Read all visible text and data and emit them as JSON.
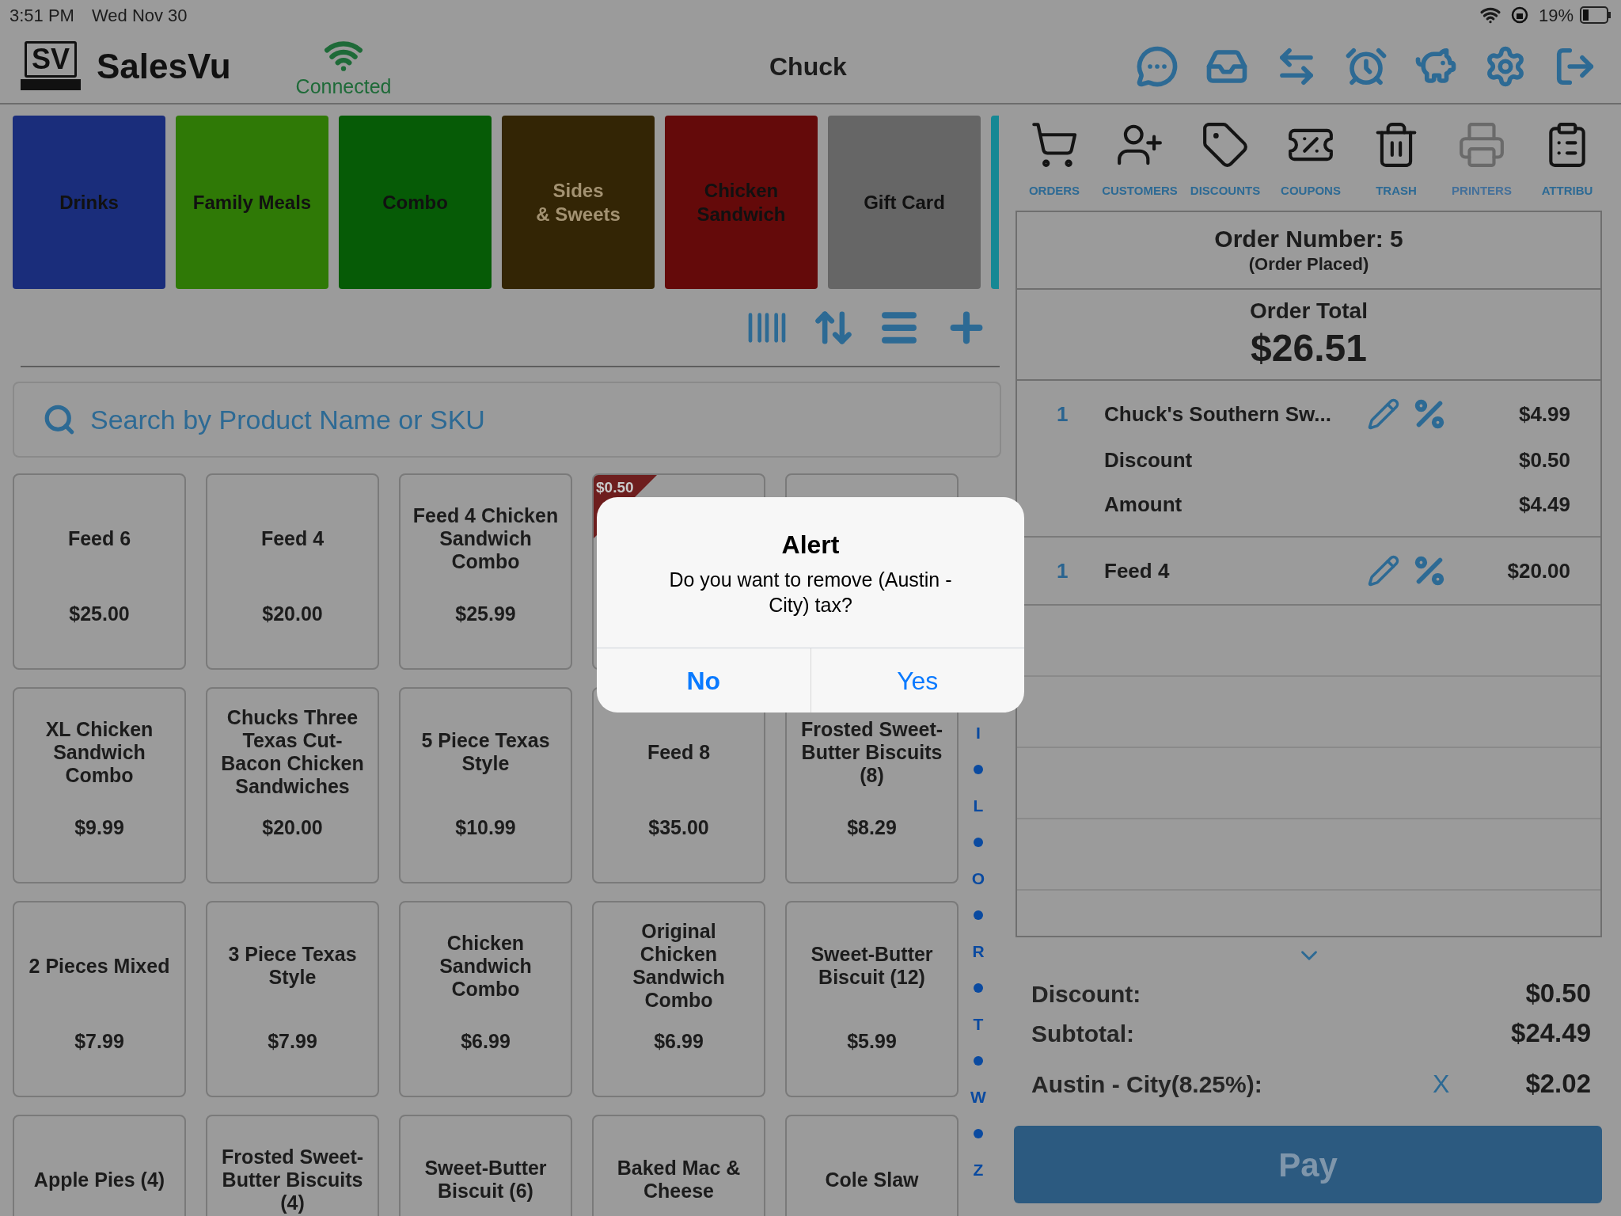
{
  "status_bar": {
    "time": "3:51 PM",
    "date": "Wed Nov 30",
    "battery": "19%"
  },
  "header": {
    "logo_text": "SV",
    "brand": "SalesVu",
    "connection": "Connected",
    "user": "Chuck"
  },
  "categories": [
    {
      "label": "Drinks",
      "color": "#1a2d7b"
    },
    {
      "label": "Family Meals",
      "color": "#2f7906"
    },
    {
      "label": "Combo",
      "color": "#065b06"
    },
    {
      "label": "Sides\n& Sweets",
      "color": "#332505"
    },
    {
      "label": "Chicken\nSandwich",
      "color": "#640a0a"
    },
    {
      "label": "Gift Card",
      "color": "#666666"
    }
  ],
  "search": {
    "placeholder": "Search by Product Name or SKU"
  },
  "products": [
    {
      "kind": "product",
      "name": "Feed 6",
      "price": "$25.00"
    },
    {
      "kind": "product",
      "name": "Feed 4",
      "price": "$20.00"
    },
    {
      "kind": "product",
      "name": "Feed 4 Chicken Sandwich Combo",
      "price": "$25.99"
    },
    {
      "kind": "covered",
      "badge": "$0.50"
    },
    {
      "kind": "covered"
    },
    {
      "kind": "product",
      "name": "XL Chicken Sandwich Combo",
      "price": "$9.99"
    },
    {
      "kind": "product",
      "name": "Chucks Three Texas Cut-Bacon Chicken Sandwiches",
      "price": "$20.00"
    },
    {
      "kind": "product",
      "name": "5 Piece Texas Style",
      "price": "$10.99"
    },
    {
      "kind": "product",
      "name": "Feed 8",
      "price": "$35.00"
    },
    {
      "kind": "product",
      "name": "Frosted Sweet-Butter Biscuits (8)",
      "price": "$8.29"
    },
    {
      "kind": "product",
      "name": "2 Pieces Mixed",
      "price": "$7.99"
    },
    {
      "kind": "product",
      "name": "3 Piece Texas Style",
      "price": "$7.99"
    },
    {
      "kind": "product",
      "name": "Chicken Sandwich Combo",
      "price": "$6.99"
    },
    {
      "kind": "product",
      "name": "Original Chicken Sandwich Combo",
      "price": "$6.99"
    },
    {
      "kind": "product",
      "name": "Sweet-Butter Biscuit (12)",
      "price": "$5.99"
    },
    {
      "kind": "product",
      "name": "Apple Pies (4)"
    },
    {
      "kind": "product",
      "name": "Frosted Sweet-Butter Biscuits (4)"
    },
    {
      "kind": "product",
      "name": "Sweet-Butter Biscuit (6)"
    },
    {
      "kind": "product",
      "name": "Baked Mac & Cheese"
    },
    {
      "kind": "product",
      "name": "Cole Slaw"
    }
  ],
  "alphabet_index": [
    {
      "kind": "letter",
      "text": "I"
    },
    {
      "kind": "dot"
    },
    {
      "kind": "letter",
      "text": "L"
    },
    {
      "kind": "dot"
    },
    {
      "kind": "letter",
      "text": "O"
    },
    {
      "kind": "dot"
    },
    {
      "kind": "letter",
      "text": "R"
    },
    {
      "kind": "dot"
    },
    {
      "kind": "letter",
      "text": "T"
    },
    {
      "kind": "dot"
    },
    {
      "kind": "letter",
      "text": "W"
    },
    {
      "kind": "dot"
    },
    {
      "kind": "letter",
      "text": "Z"
    }
  ],
  "tools": [
    {
      "label": "ORDERS",
      "disabled": false
    },
    {
      "label": "CUSTOMERS",
      "disabled": false
    },
    {
      "label": "DISCOUNTS",
      "disabled": false
    },
    {
      "label": "COUPONS",
      "disabled": false
    },
    {
      "label": "TRASH",
      "disabled": false
    },
    {
      "label": "PRINTERS",
      "disabled": true
    },
    {
      "label": "ATTRIBU",
      "disabled": false
    }
  ],
  "order": {
    "number": "Order Number: 5",
    "status": "(Order Placed)",
    "total_label": "Order Total",
    "total": "$26.51",
    "lines": [
      {
        "qty": "1",
        "name": "Chuck's Southern Sw...",
        "price": "$4.99",
        "details": [
          {
            "label": "Discount",
            "value": "$0.50"
          },
          {
            "label": "Amount",
            "value": "$4.49"
          }
        ]
      },
      {
        "qty": "1",
        "name": "Feed 4",
        "price": "$20.00"
      }
    ]
  },
  "summary": [
    {
      "label": "Discount:",
      "value": "$0.50"
    },
    {
      "label": "Subtotal:",
      "value": "$24.49"
    },
    {
      "label": "Austin - City(8.25%):",
      "value": "$2.02",
      "remove": "X"
    }
  ],
  "pay_button": "Pay",
  "dialog": {
    "title": "Alert",
    "message": "Do you want to remove (Austin - City) tax?",
    "buttons": [
      {
        "label": "No",
        "bold": true
      },
      {
        "label": "Yes",
        "bold": false
      }
    ]
  }
}
